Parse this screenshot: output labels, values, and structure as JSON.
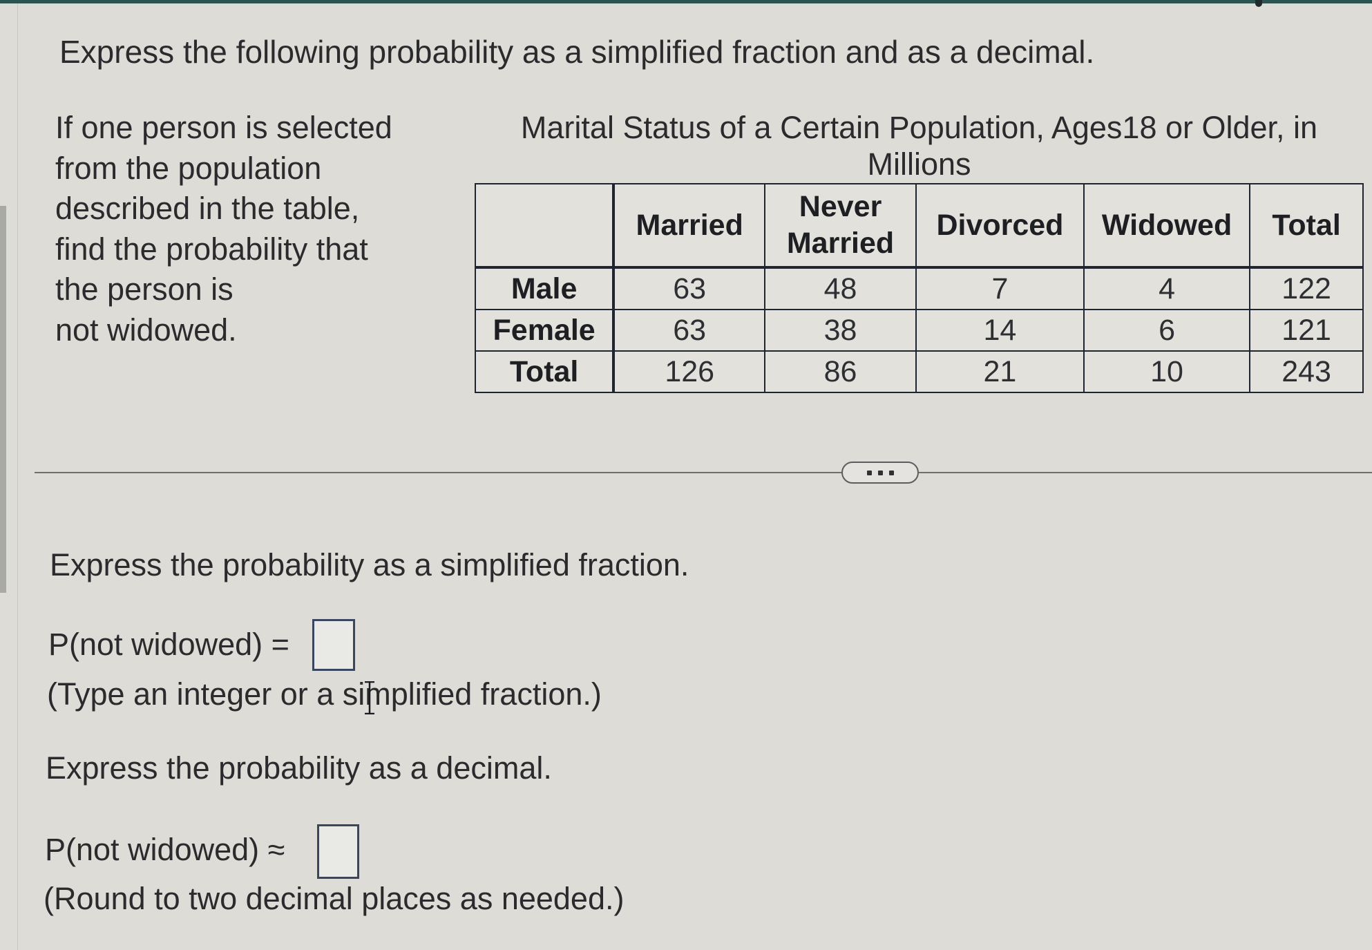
{
  "page": {
    "title": "Express the following probability as a simplified fraction and as a decimal."
  },
  "question": {
    "lines": [
      "If one person is selected",
      "from the population",
      "described in the table,",
      "find the probability that",
      "the person is",
      "not widowed."
    ]
  },
  "table": {
    "caption": "Marital Status of a Certain Population, Ages18 or Older, in Millions",
    "columns": [
      "",
      "Married",
      "Never Married",
      "Divorced",
      "Widowed",
      "Total"
    ],
    "rows": [
      {
        "label": "Male",
        "values": [
          "63",
          "48",
          "7",
          "4",
          "122"
        ]
      },
      {
        "label": "Female",
        "values": [
          "63",
          "38",
          "14",
          "6",
          "121"
        ]
      },
      {
        "label": "Total",
        "values": [
          "126",
          "86",
          "21",
          "10",
          "243"
        ]
      }
    ]
  },
  "more_button": {
    "icon": "ellipsis-icon"
  },
  "part_fraction": {
    "instruction": "Express the probability as a simplified fraction.",
    "prompt": "P(not widowed) =",
    "answer_value": "",
    "hint": "(Type an integer or a simplified fraction.)"
  },
  "part_decimal": {
    "instruction": "Express the probability as a decimal.",
    "prompt": "P(not widowed) ≈",
    "answer_value": "",
    "hint": "(Round to two decimal places as needed.)"
  },
  "colors": {
    "background": "#dddcd7",
    "top_strip": "#2c5551",
    "answer_box_border": "#3a4660",
    "text": "#2b2b2e"
  }
}
